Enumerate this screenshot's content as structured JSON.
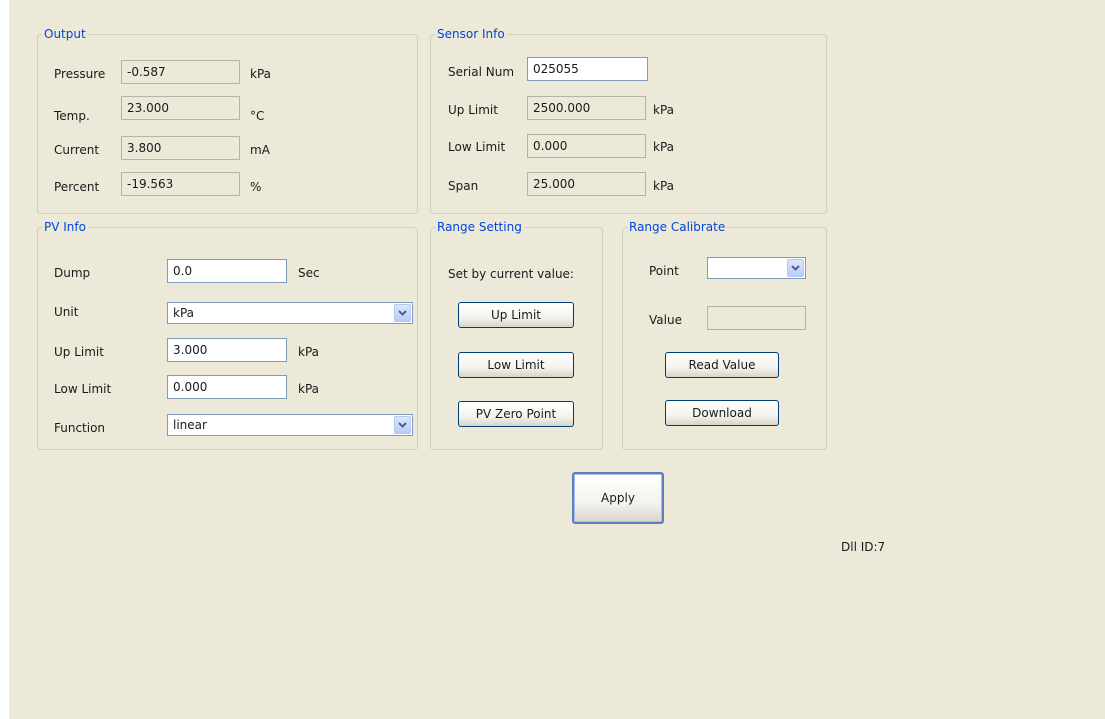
{
  "output": {
    "title": "Output",
    "rows": [
      {
        "label": "Pressure",
        "value": "-0.587",
        "unit": "kPa"
      },
      {
        "label": "Temp.",
        "value": "23.000",
        "unit": "°C"
      },
      {
        "label": "Current",
        "value": "3.800",
        "unit": "mA"
      },
      {
        "label": "Percent",
        "value": "-19.563",
        "unit": "%"
      }
    ]
  },
  "sensor_info": {
    "title": "Sensor Info",
    "serial_label": "Serial Num",
    "serial_value": "025055",
    "rows": [
      {
        "label": "Up Limit",
        "value": "2500.000",
        "unit": "kPa"
      },
      {
        "label": "Low Limit",
        "value": "0.000",
        "unit": "kPa"
      },
      {
        "label": "Span",
        "value": "25.000",
        "unit": "kPa"
      }
    ]
  },
  "pv_info": {
    "title": "PV Info",
    "dump_label": "Dump",
    "dump_value": "0.0",
    "dump_unit": "Sec",
    "unit_label": "Unit",
    "unit_value": "kPa",
    "up_limit_label": "Up Limit",
    "up_limit_value": "3.000",
    "up_limit_unit": "kPa",
    "low_limit_label": "Low Limit",
    "low_limit_value": "0.000",
    "low_limit_unit": "kPa",
    "function_label": "Function",
    "function_value": "linear"
  },
  "range_setting": {
    "title": "Range Setting",
    "caption": "Set by current value:",
    "up_limit_button": "Up Limit",
    "low_limit_button": "Low Limit",
    "pv_zero_button": "PV Zero Point"
  },
  "range_calibrate": {
    "title": "Range Calibrate",
    "point_label": "Point",
    "point_value": "",
    "value_label": "Value",
    "value_value": "",
    "read_button": "Read Value",
    "download_button": "Download"
  },
  "apply_label": "Apply",
  "dll_id": "Dll ID:7",
  "colors": {
    "panel_bg": "#ece9d8",
    "group_title": "#0046d5",
    "button_border": "#003c74"
  },
  "icons": {
    "dropdown": "chevron-down-icon"
  }
}
